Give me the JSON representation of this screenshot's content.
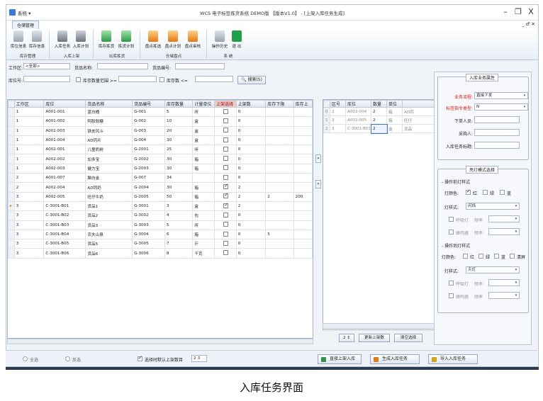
{
  "window": {
    "system_menu": "系统 ▾",
    "title": "WCS 电子标签拣货系统 DEMO版 【版本V1.0】 - [上架入库任务生成]",
    "minimize": "–",
    "maximize": "❐",
    "close": "X",
    "sub_controls": "_ ♂ ✕"
  },
  "tab": {
    "label": "仓储管理"
  },
  "ribbon": {
    "buttons": [
      "库位信息",
      "库存信息",
      "入库任务",
      "入库计划",
      "库存拣货",
      "拣货计划",
      "盘点拣选",
      "盘点计划",
      "盘点审核",
      "操作历史",
      "退 出"
    ],
    "groups": [
      "库存管理",
      "入库上架",
      "出库拣货",
      "仓储盘点",
      "系 统"
    ]
  },
  "filters": {
    "workzone_label": "工作区:",
    "workzone_value": "<全部>",
    "goods_name_label": "货品名称:",
    "goods_code_label": "货品编号:",
    "location_label": "库位号:",
    "qty_range_label": "库存数量范围 >=",
    "qty_le_label": "库存数 <=",
    "search_label": "搜索(S)"
  },
  "grid": {
    "columns": [
      "工作区",
      "库位",
      "货品名称",
      "货品编号",
      "库存数量",
      "计量单位",
      "上架选择",
      "上架数",
      "库存下限",
      "库存上"
    ],
    "rows": [
      {
        "zone": "1",
        "loc": "A001-001",
        "name": "蓝白桶",
        "code": "G-001",
        "qty": "5",
        "unit": "听",
        "sel": false,
        "put": "0",
        "min": "",
        "max": ""
      },
      {
        "zone": "1",
        "loc": "A001-002",
        "name": "阿胶软糖",
        "code": "G-002",
        "qty": "10",
        "unit": "盒",
        "sel": false,
        "put": "0",
        "min": "",
        "max": ""
      },
      {
        "zone": "1",
        "loc": "A001-003",
        "name": "铁皮风斗",
        "code": "G-003",
        "qty": "20",
        "unit": "盒",
        "sel": false,
        "put": "0",
        "min": "",
        "max": ""
      },
      {
        "zone": "1",
        "loc": "A001-004",
        "name": "AD钙片",
        "code": "G-004",
        "qty": "30",
        "unit": "盒",
        "sel": false,
        "put": "0",
        "min": "",
        "max": ""
      },
      {
        "zone": "1",
        "loc": "A002-001",
        "name": "儿童奶粉",
        "code": "G-2001",
        "qty": "25",
        "unit": "听",
        "sel": false,
        "put": "0",
        "min": "",
        "max": ""
      },
      {
        "zone": "1",
        "loc": "A002-002",
        "name": "加多宝",
        "code": "G-2002",
        "qty": "30",
        "unit": "箱",
        "sel": false,
        "put": "0",
        "min": "",
        "max": ""
      },
      {
        "zone": "1",
        "loc": "A002-003",
        "name": "健力宝",
        "code": "G-2003",
        "qty": "30",
        "unit": "箱",
        "sel": false,
        "put": "0",
        "min": "",
        "max": ""
      },
      {
        "zone": "2",
        "loc": "A001-007",
        "name": "脑白金",
        "code": "G-007",
        "qty": "34",
        "unit": "",
        "sel": false,
        "put": "0",
        "min": "",
        "max": ""
      },
      {
        "zone": "2",
        "loc": "A002-004",
        "name": "AD钙奶",
        "code": "G-2004",
        "qty": "30",
        "unit": "箱",
        "sel": true,
        "put": "2",
        "min": "",
        "max": ""
      },
      {
        "zone": "3",
        "loc": "A002-005",
        "name": "旺仔牛奶",
        "code": "G-2005",
        "qty": "50",
        "unit": "箱",
        "sel": true,
        "put": "2",
        "min": "2",
        "max": "200"
      },
      {
        "zone": "3",
        "loc": "C-3001-B01",
        "name": "货品1",
        "code": "G-3001",
        "qty": "3",
        "unit": "盒",
        "sel": true,
        "put": "2",
        "min": "",
        "max": ""
      },
      {
        "zone": "3",
        "loc": "C-3001-B02",
        "name": "货品2",
        "code": "G-3002",
        "qty": "4",
        "unit": "包",
        "sel": false,
        "put": "0",
        "min": "",
        "max": ""
      },
      {
        "zone": "3",
        "loc": "C-3001-B03",
        "name": "货品3",
        "code": "G-3003",
        "qty": "5",
        "unit": "听",
        "sel": false,
        "put": "0",
        "min": "",
        "max": ""
      },
      {
        "zone": "3",
        "loc": "C-3001-B04",
        "name": "农夫山泉",
        "code": "G-3004",
        "qty": "6",
        "unit": "箱",
        "sel": false,
        "put": "0",
        "min": "5",
        "max": ""
      },
      {
        "zone": "3",
        "loc": "C-3001-B05",
        "name": "货品5",
        "code": "G-3005",
        "qty": "7",
        "unit": "斤",
        "sel": false,
        "put": "0",
        "min": "",
        "max": ""
      },
      {
        "zone": "3",
        "loc": "C-3001-B06",
        "name": "货品6",
        "code": "G-3006",
        "qty": "8",
        "unit": "千克",
        "sel": false,
        "put": "0",
        "min": "",
        "max": ""
      }
    ]
  },
  "mid_buttons": {
    "right": "»",
    "left": "«"
  },
  "right_grid": {
    "columns": [
      "区号",
      "库位",
      "数量",
      "单位",
      ""
    ],
    "rows": [
      {
        "idx": "0",
        "zone": "2",
        "loc": "A002-004",
        "qty": "2",
        "unit": "箱",
        "extra": "AD钙"
      },
      {
        "idx": "1",
        "zone": "3",
        "loc": "A002-005",
        "qty": "2",
        "unit": "箱",
        "extra": "旺仔"
      },
      {
        "idx": "2",
        "zone": "3",
        "loc": "C-3001-B01",
        "qty": "2",
        "unit": "盒",
        "extra": "货品"
      }
    ],
    "qty_value": "2",
    "update_label": "更新上架数",
    "clear_label": "清空选择"
  },
  "panel": {
    "attr_title": "入库业务属性",
    "biz_flow_label": "业务流程:",
    "biz_flow_value": "直接下发",
    "cmd_type_label": "标签指令类型:",
    "cmd_type_value": "N",
    "issuer_label": "下单人员:",
    "picker_label": "采购人:",
    "task_tag_label": "入库任务标题:",
    "light_title": "亮灯模式选择",
    "before_label": "操作前灯样式",
    "color_label": "灯颜色:",
    "red": "红",
    "green": "绿",
    "blue": "蓝",
    "clear": "清屏",
    "style_label": "灯样式:",
    "style_before": "闪烁",
    "breath_label": "呼吸灯",
    "freq_label": "频率",
    "buzzer_label": "蜂鸣器",
    "after_label": "操作后灯样式",
    "style_after": "灭灯"
  },
  "bottom": {
    "select_all": "全选",
    "invert": "反选",
    "default_qty_label": "选择时默认上架数目",
    "default_qty_value": "2",
    "direct_putaway": "直接上架入库",
    "gen_task": "生成入库任务",
    "import_task": "导入入库任务"
  },
  "caption": "入库任务界面",
  "colors": {
    "required_label": "#d01818",
    "selection_header": "#e9c9c9"
  }
}
